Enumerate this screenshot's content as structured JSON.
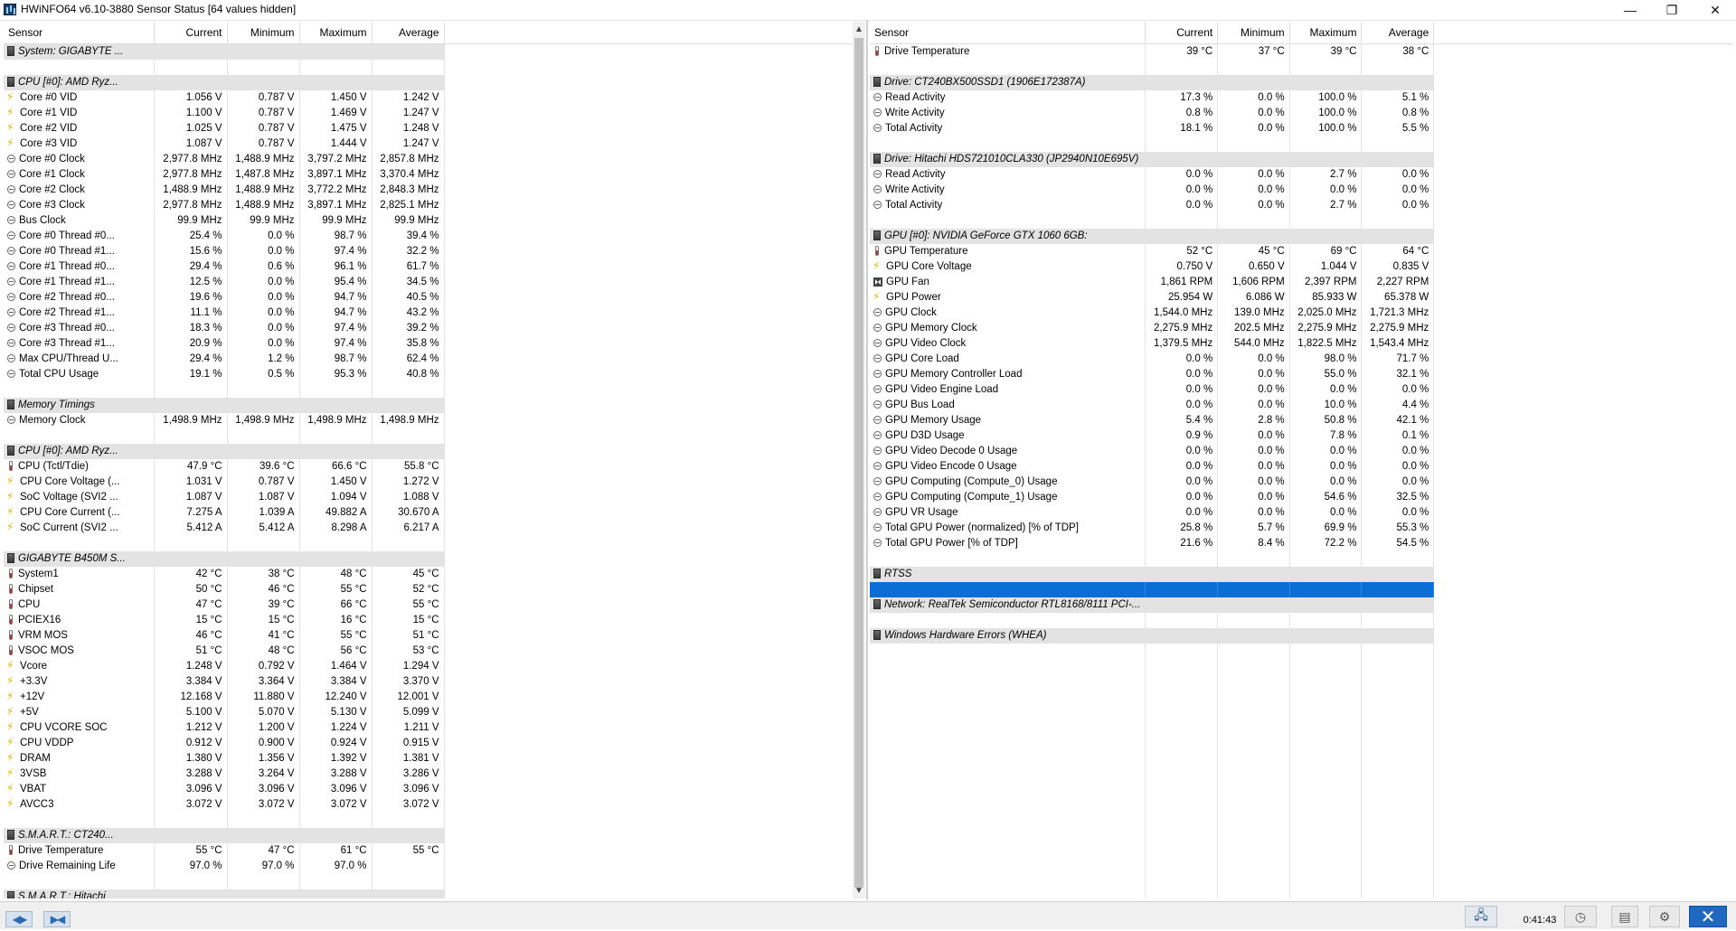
{
  "window": {
    "title": "HWiNFO64 v6.10-3880 Sensor Status [64 values hidden]",
    "min_glyph": "—",
    "max_glyph": "❐",
    "close_glyph": "✕"
  },
  "columns": [
    "Sensor",
    "Current",
    "Minimum",
    "Maximum",
    "Average"
  ],
  "left_rows": [
    {
      "t": "g",
      "n": "System: GIGABYTE ..."
    },
    {
      "t": "b"
    },
    {
      "t": "g",
      "n": "CPU [#0]: AMD Ryz..."
    },
    {
      "t": "s",
      "i": "volt",
      "n": "Core #0 VID",
      "v": [
        "1.056 V",
        "0.787 V",
        "1.450 V",
        "1.242 V"
      ]
    },
    {
      "t": "s",
      "i": "volt",
      "n": "Core #1 VID",
      "v": [
        "1.100 V",
        "0.787 V",
        "1.469 V",
        "1.247 V"
      ]
    },
    {
      "t": "s",
      "i": "volt",
      "n": "Core #2 VID",
      "v": [
        "1.025 V",
        "0.787 V",
        "1.475 V",
        "1.248 V"
      ]
    },
    {
      "t": "s",
      "i": "volt",
      "n": "Core #3 VID",
      "v": [
        "1.087 V",
        "0.787 V",
        "1.444 V",
        "1.247 V"
      ]
    },
    {
      "t": "s",
      "i": "clock",
      "n": "Core #0 Clock",
      "v": [
        "2,977.8 MHz",
        "1,488.9 MHz",
        "3,797.2 MHz",
        "2,857.8 MHz"
      ]
    },
    {
      "t": "s",
      "i": "clock",
      "n": "Core #1 Clock",
      "v": [
        "2,977.8 MHz",
        "1,487.8 MHz",
        "3,897.1 MHz",
        "3,370.4 MHz"
      ]
    },
    {
      "t": "s",
      "i": "clock",
      "n": "Core #2 Clock",
      "v": [
        "1,488.9 MHz",
        "1,488.9 MHz",
        "3,772.2 MHz",
        "2,848.3 MHz"
      ]
    },
    {
      "t": "s",
      "i": "clock",
      "n": "Core #3 Clock",
      "v": [
        "2,977.8 MHz",
        "1,488.9 MHz",
        "3,897.1 MHz",
        "2,825.1 MHz"
      ]
    },
    {
      "t": "s",
      "i": "clock",
      "n": "Bus Clock",
      "v": [
        "99.9 MHz",
        "99.9 MHz",
        "99.9 MHz",
        "99.9 MHz"
      ]
    },
    {
      "t": "s",
      "i": "clock",
      "n": "Core #0 Thread #0...",
      "v": [
        "25.4 %",
        "0.0 %",
        "98.7 %",
        "39.4 %"
      ]
    },
    {
      "t": "s",
      "i": "clock",
      "n": "Core #0 Thread #1...",
      "v": [
        "15.6 %",
        "0.0 %",
        "97.4 %",
        "32.2 %"
      ]
    },
    {
      "t": "s",
      "i": "clock",
      "n": "Core #1 Thread #0...",
      "v": [
        "29.4 %",
        "0.6 %",
        "96.1 %",
        "61.7 %"
      ]
    },
    {
      "t": "s",
      "i": "clock",
      "n": "Core #1 Thread #1...",
      "v": [
        "12.5 %",
        "0.0 %",
        "95.4 %",
        "34.5 %"
      ]
    },
    {
      "t": "s",
      "i": "clock",
      "n": "Core #2 Thread #0...",
      "v": [
        "19.6 %",
        "0.0 %",
        "94.7 %",
        "40.5 %"
      ]
    },
    {
      "t": "s",
      "i": "clock",
      "n": "Core #2 Thread #1...",
      "v": [
        "11.1 %",
        "0.0 %",
        "94.7 %",
        "43.2 %"
      ]
    },
    {
      "t": "s",
      "i": "clock",
      "n": "Core #3 Thread #0...",
      "v": [
        "18.3 %",
        "0.0 %",
        "97.4 %",
        "39.2 %"
      ]
    },
    {
      "t": "s",
      "i": "clock",
      "n": "Core #3 Thread #1...",
      "v": [
        "20.9 %",
        "0.0 %",
        "97.4 %",
        "35.8 %"
      ]
    },
    {
      "t": "s",
      "i": "clock",
      "n": "Max CPU/Thread U...",
      "v": [
        "29.4 %",
        "1.2 %",
        "98.7 %",
        "62.4 %"
      ]
    },
    {
      "t": "s",
      "i": "clock",
      "n": "Total CPU Usage",
      "v": [
        "19.1 %",
        "0.5 %",
        "95.3 %",
        "40.8 %"
      ]
    },
    {
      "t": "b"
    },
    {
      "t": "g",
      "n": "Memory Timings"
    },
    {
      "t": "s",
      "i": "clock",
      "n": "Memory Clock",
      "v": [
        "1,498.9 MHz",
        "1,498.9 MHz",
        "1,498.9 MHz",
        "1,498.9 MHz"
      ]
    },
    {
      "t": "b"
    },
    {
      "t": "g",
      "n": "CPU [#0]: AMD Ryz..."
    },
    {
      "t": "s",
      "i": "temp",
      "n": "CPU (Tctl/Tdie)",
      "v": [
        "47.9 °C",
        "39.6 °C",
        "66.6 °C",
        "55.8 °C"
      ]
    },
    {
      "t": "s",
      "i": "volt",
      "n": "CPU Core Voltage (...",
      "v": [
        "1.031 V",
        "0.787 V",
        "1.450 V",
        "1.272 V"
      ]
    },
    {
      "t": "s",
      "i": "volt",
      "n": "SoC Voltage (SVI2 ...",
      "v": [
        "1.087 V",
        "1.087 V",
        "1.094 V",
        "1.088 V"
      ]
    },
    {
      "t": "s",
      "i": "volt",
      "n": "CPU Core Current (...",
      "v": [
        "7.275 A",
        "1.039 A",
        "49.882 A",
        "30.670 A"
      ]
    },
    {
      "t": "s",
      "i": "volt",
      "n": "SoC Current (SVI2 ...",
      "v": [
        "5.412 A",
        "5.412 A",
        "8.298 A",
        "6.217 A"
      ]
    },
    {
      "t": "b"
    },
    {
      "t": "g",
      "n": "GIGABYTE B450M S..."
    },
    {
      "t": "s",
      "i": "temp",
      "n": "System1",
      "v": [
        "42 °C",
        "38 °C",
        "48 °C",
        "45 °C"
      ]
    },
    {
      "t": "s",
      "i": "temp",
      "n": "Chipset",
      "v": [
        "50 °C",
        "46 °C",
        "55 °C",
        "52 °C"
      ]
    },
    {
      "t": "s",
      "i": "temp",
      "n": "CPU",
      "v": [
        "47 °C",
        "39 °C",
        "66 °C",
        "55 °C"
      ]
    },
    {
      "t": "s",
      "i": "temp",
      "n": "PCIEX16",
      "v": [
        "15 °C",
        "15 °C",
        "16 °C",
        "15 °C"
      ]
    },
    {
      "t": "s",
      "i": "temp",
      "n": "VRM MOS",
      "v": [
        "46 °C",
        "41 °C",
        "55 °C",
        "51 °C"
      ]
    },
    {
      "t": "s",
      "i": "temp",
      "n": "VSOC MOS",
      "v": [
        "51 °C",
        "48 °C",
        "56 °C",
        "53 °C"
      ]
    },
    {
      "t": "s",
      "i": "volt",
      "n": "Vcore",
      "v": [
        "1.248 V",
        "0.792 V",
        "1.464 V",
        "1.294 V"
      ]
    },
    {
      "t": "s",
      "i": "volt",
      "n": "+3.3V",
      "v": [
        "3.384 V",
        "3.364 V",
        "3.384 V",
        "3.370 V"
      ]
    },
    {
      "t": "s",
      "i": "volt",
      "n": "+12V",
      "v": [
        "12.168 V",
        "11.880 V",
        "12.240 V",
        "12.001 V"
      ]
    },
    {
      "t": "s",
      "i": "volt",
      "n": "+5V",
      "v": [
        "5.100 V",
        "5.070 V",
        "5.130 V",
        "5.099 V"
      ]
    },
    {
      "t": "s",
      "i": "volt",
      "n": "CPU VCORE SOC",
      "v": [
        "1.212 V",
        "1.200 V",
        "1.224 V",
        "1.211 V"
      ]
    },
    {
      "t": "s",
      "i": "volt",
      "n": "CPU VDDP",
      "v": [
        "0.912 V",
        "0.900 V",
        "0.924 V",
        "0.915 V"
      ]
    },
    {
      "t": "s",
      "i": "volt",
      "n": "DRAM",
      "v": [
        "1.380 V",
        "1.356 V",
        "1.392 V",
        "1.381 V"
      ]
    },
    {
      "t": "s",
      "i": "volt",
      "n": "3VSB",
      "v": [
        "3.288 V",
        "3.264 V",
        "3.288 V",
        "3.286 V"
      ]
    },
    {
      "t": "s",
      "i": "volt",
      "n": "VBAT",
      "v": [
        "3.096 V",
        "3.096 V",
        "3.096 V",
        "3.096 V"
      ]
    },
    {
      "t": "s",
      "i": "volt",
      "n": "AVCC3",
      "v": [
        "3.072 V",
        "3.072 V",
        "3.072 V",
        "3.072 V"
      ]
    },
    {
      "t": "b"
    },
    {
      "t": "g",
      "n": "S.M.A.R.T.: CT240..."
    },
    {
      "t": "s",
      "i": "temp",
      "n": "Drive Temperature",
      "v": [
        "55 °C",
        "47 °C",
        "61 °C",
        "55 °C"
      ]
    },
    {
      "t": "s",
      "i": "clock",
      "n": "Drive Remaining Life",
      "v": [
        "97.0 %",
        "97.0 %",
        "97.0 %",
        ""
      ]
    },
    {
      "t": "b"
    },
    {
      "t": "g",
      "n": "S.M.A.R.T.: Hitachi"
    }
  ],
  "right_rows": [
    {
      "t": "s",
      "i": "temp",
      "n": "Drive Temperature",
      "v": [
        "39 °C",
        "37 °C",
        "39 °C",
        "38 °C"
      ]
    },
    {
      "t": "b"
    },
    {
      "t": "g",
      "n": "Drive: CT240BX500SSD1 (1906E172387A)"
    },
    {
      "t": "s",
      "i": "clock",
      "n": "Read Activity",
      "v": [
        "17.3 %",
        "0.0 %",
        "100.0 %",
        "5.1 %"
      ]
    },
    {
      "t": "s",
      "i": "clock",
      "n": "Write Activity",
      "v": [
        "0.8 %",
        "0.0 %",
        "100.0 %",
        "0.8 %"
      ]
    },
    {
      "t": "s",
      "i": "clock",
      "n": "Total Activity",
      "v": [
        "18.1 %",
        "0.0 %",
        "100.0 %",
        "5.5 %"
      ]
    },
    {
      "t": "b"
    },
    {
      "t": "g",
      "n": "Drive: Hitachi HDS721010CLA330 (JP2940N10E695V)"
    },
    {
      "t": "s",
      "i": "clock",
      "n": "Read Activity",
      "v": [
        "0.0 %",
        "0.0 %",
        "2.7 %",
        "0.0 %"
      ]
    },
    {
      "t": "s",
      "i": "clock",
      "n": "Write Activity",
      "v": [
        "0.0 %",
        "0.0 %",
        "0.0 %",
        "0.0 %"
      ]
    },
    {
      "t": "s",
      "i": "clock",
      "n": "Total Activity",
      "v": [
        "0.0 %",
        "0.0 %",
        "2.7 %",
        "0.0 %"
      ]
    },
    {
      "t": "b"
    },
    {
      "t": "g",
      "n": "GPU [#0]: NVIDIA GeForce GTX 1060 6GB:"
    },
    {
      "t": "s",
      "i": "temp",
      "n": "GPU Temperature",
      "v": [
        "52 °C",
        "45 °C",
        "69 °C",
        "64 °C"
      ]
    },
    {
      "t": "s",
      "i": "volt",
      "n": "GPU Core Voltage",
      "v": [
        "0.750 V",
        "0.650 V",
        "1.044 V",
        "0.835 V"
      ]
    },
    {
      "t": "s",
      "i": "fan",
      "n": "GPU Fan",
      "v": [
        "1,861 RPM",
        "1,606 RPM",
        "2,397 RPM",
        "2,227 RPM"
      ]
    },
    {
      "t": "s",
      "i": "volt",
      "n": "GPU Power",
      "v": [
        "25.954 W",
        "6.086 W",
        "85.933 W",
        "65.378 W"
      ]
    },
    {
      "t": "s",
      "i": "clock",
      "n": "GPU Clock",
      "v": [
        "1,544.0 MHz",
        "139.0 MHz",
        "2,025.0 MHz",
        "1,721.3 MHz"
      ]
    },
    {
      "t": "s",
      "i": "clock",
      "n": "GPU Memory Clock",
      "v": [
        "2,275.9 MHz",
        "202.5 MHz",
        "2,275.9 MHz",
        "2,275.9 MHz"
      ]
    },
    {
      "t": "s",
      "i": "clock",
      "n": "GPU Video Clock",
      "v": [
        "1,379.5 MHz",
        "544.0 MHz",
        "1,822.5 MHz",
        "1,543.4 MHz"
      ]
    },
    {
      "t": "s",
      "i": "clock",
      "n": "GPU Core Load",
      "v": [
        "0.0 %",
        "0.0 %",
        "98.0 %",
        "71.7 %"
      ]
    },
    {
      "t": "s",
      "i": "clock",
      "n": "GPU Memory Controller Load",
      "v": [
        "0.0 %",
        "0.0 %",
        "55.0 %",
        "32.1 %"
      ]
    },
    {
      "t": "s",
      "i": "clock",
      "n": "GPU Video Engine Load",
      "v": [
        "0.0 %",
        "0.0 %",
        "0.0 %",
        "0.0 %"
      ]
    },
    {
      "t": "s",
      "i": "clock",
      "n": "GPU Bus Load",
      "v": [
        "0.0 %",
        "0.0 %",
        "10.0 %",
        "4.4 %"
      ]
    },
    {
      "t": "s",
      "i": "clock",
      "n": "GPU Memory Usage",
      "v": [
        "5.4 %",
        "2.8 %",
        "50.8 %",
        "42.1 %"
      ]
    },
    {
      "t": "s",
      "i": "clock",
      "n": "GPU D3D Usage",
      "v": [
        "0.9 %",
        "0.0 %",
        "7.8 %",
        "0.1 %"
      ]
    },
    {
      "t": "s",
      "i": "clock",
      "n": "GPU Video Decode 0 Usage",
      "v": [
        "0.0 %",
        "0.0 %",
        "0.0 %",
        "0.0 %"
      ]
    },
    {
      "t": "s",
      "i": "clock",
      "n": "GPU Video Encode 0 Usage",
      "v": [
        "0.0 %",
        "0.0 %",
        "0.0 %",
        "0.0 %"
      ]
    },
    {
      "t": "s",
      "i": "clock",
      "n": "GPU Computing (Compute_0) Usage",
      "v": [
        "0.0 %",
        "0.0 %",
        "0.0 %",
        "0.0 %"
      ]
    },
    {
      "t": "s",
      "i": "clock",
      "n": "GPU Computing (Compute_1) Usage",
      "v": [
        "0.0 %",
        "0.0 %",
        "54.6 %",
        "32.5 %"
      ]
    },
    {
      "t": "s",
      "i": "clock",
      "n": "GPU VR Usage",
      "v": [
        "0.0 %",
        "0.0 %",
        "0.0 %",
        "0.0 %"
      ]
    },
    {
      "t": "s",
      "i": "clock",
      "n": "Total GPU Power (normalized) [% of TDP]",
      "v": [
        "25.8 %",
        "5.7 %",
        "69.9 %",
        "55.3 %"
      ]
    },
    {
      "t": "s",
      "i": "clock",
      "n": "Total GPU Power [% of TDP]",
      "v": [
        "21.6 %",
        "8.4 %",
        "72.2 %",
        "54.5 %"
      ]
    },
    {
      "t": "b"
    },
    {
      "t": "g",
      "n": "RTSS"
    },
    {
      "t": "sel"
    },
    {
      "t": "g",
      "n": "Network: RealTek Semiconductor RTL8168/8111 PCI-..."
    },
    {
      "t": "b"
    },
    {
      "t": "g",
      "n": "Windows Hardware Errors (WHEA)"
    },
    {
      "t": "b"
    },
    {
      "t": "b"
    },
    {
      "t": "b"
    },
    {
      "t": "b"
    },
    {
      "t": "b"
    },
    {
      "t": "b"
    },
    {
      "t": "b"
    },
    {
      "t": "b"
    },
    {
      "t": "b"
    },
    {
      "t": "b"
    },
    {
      "t": "b"
    },
    {
      "t": "b"
    },
    {
      "t": "b"
    },
    {
      "t": "b"
    },
    {
      "t": "b"
    },
    {
      "t": "b"
    },
    {
      "t": "b"
    },
    {
      "t": "b"
    },
    {
      "t": "b"
    },
    {
      "t": "b"
    },
    {
      "t": "b"
    }
  ],
  "statusbar": {
    "nav_left": "◀▶",
    "nav_right": "▶◀",
    "elapsed_time": "0:41:43",
    "net_icon": "network-icon",
    "timer_icon": "clock-icon",
    "report_icon": "report-icon",
    "settings_icon": "settings-icon",
    "exit_glyph": "✕"
  },
  "scroll": {
    "up_glyph": "▲",
    "down_glyph": "▼"
  },
  "colors": {
    "group_bg": "#e3e3e3",
    "selection": "#0a6ed6",
    "exit_button": "#1f68c2"
  }
}
